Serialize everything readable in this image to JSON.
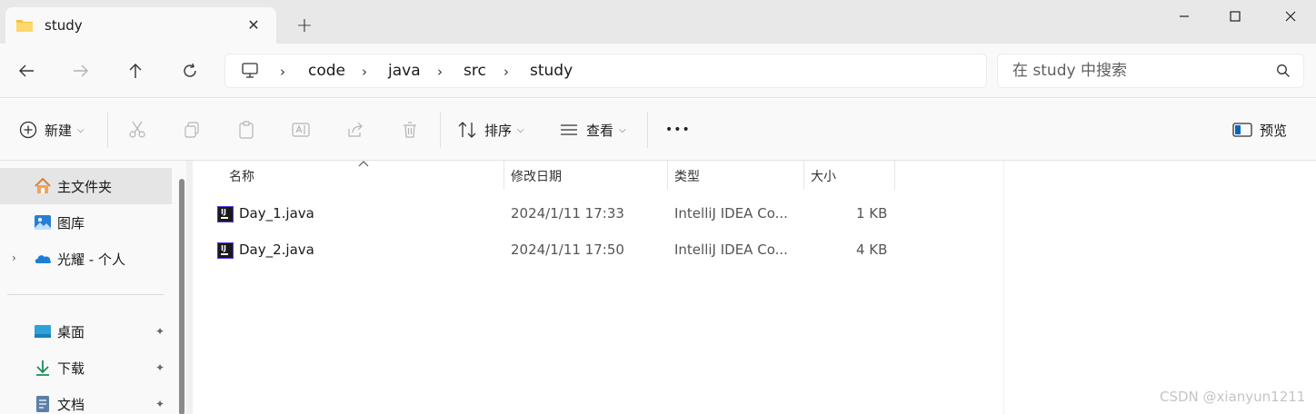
{
  "tab": {
    "title": "study",
    "close_label": "✕",
    "new_label": "+"
  },
  "window": {
    "min_label": "—",
    "max_label": "□",
    "close_label": "✕"
  },
  "breadcrumb": [
    "code",
    "java",
    "src",
    "study"
  ],
  "breadcrumb_separator": "›",
  "search": {
    "placeholder": "在 study 中搜索"
  },
  "commands": {
    "new": "新建",
    "sort": "排序",
    "view": "查看",
    "more": "•••",
    "preview": "预览"
  },
  "sidebar": {
    "items": [
      {
        "label": "主文件夹",
        "icon": "home-icon"
      },
      {
        "label": "图库",
        "icon": "gallery-icon"
      },
      {
        "label": "光耀 - 个人",
        "icon": "onedrive-icon"
      },
      {
        "label": "桌面",
        "icon": "desktop-icon"
      },
      {
        "label": "下载",
        "icon": "download-icon"
      },
      {
        "label": "文档",
        "icon": "document-icon"
      }
    ],
    "pin_label": "📌"
  },
  "columns": {
    "name": "名称",
    "modified": "修改日期",
    "type": "类型",
    "size": "大小"
  },
  "files": [
    {
      "name": "Day_1.java",
      "modified": "2024/1/11 17:33",
      "type": "IntelliJ IDEA Co...",
      "size": "1 KB"
    },
    {
      "name": "Day_2.java",
      "modified": "2024/1/11 17:50",
      "type": "IntelliJ IDEA Co...",
      "size": "4 KB"
    }
  ],
  "watermark": "CSDN @xianyun1211",
  "colors": {
    "accent": "#0067c0",
    "folder": "#f5c242",
    "selection": "#e5e5e5"
  }
}
